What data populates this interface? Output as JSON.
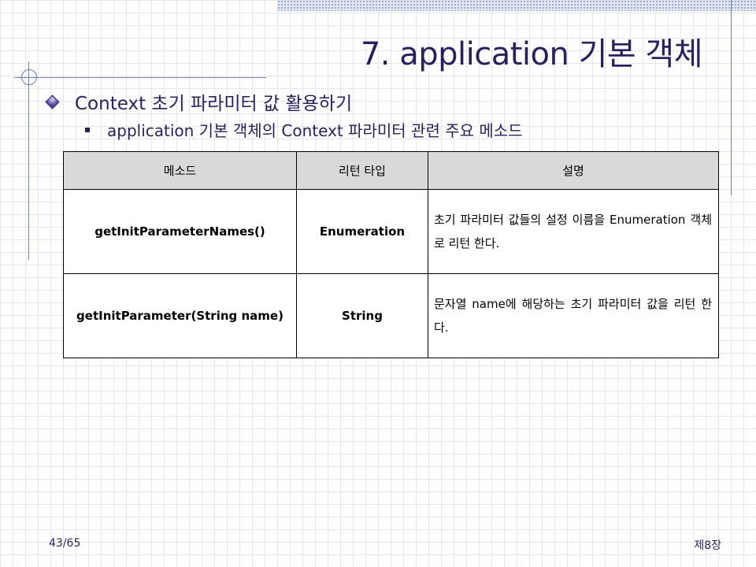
{
  "slide": {
    "title": "7. application 기본 객체",
    "bullet1": "Context 초기 파라미터 값 활용하기",
    "bullet2": "application 기본 객체의 Context 파라미터 관련 주요 메소드"
  },
  "table": {
    "headers": [
      "메소드",
      "리턴 타입",
      "설명"
    ],
    "rows": [
      {
        "method": "getInitParameterNames()",
        "return_type": "Enumeration",
        "description": "초기 파라미터 값들의 설정 이름을 Enumeration 객체로 리턴 한다."
      },
      {
        "method": "getInitParameter(String name)",
        "return_type": "String",
        "description": "문자열 name에 해당하는 초기 파라미터 값을 리턴 한다."
      }
    ]
  },
  "footer": {
    "page": "43/65",
    "chapter": "제8장"
  },
  "colors": {
    "text_primary": "#2c1f5e",
    "accent_line": "#6f7fa8",
    "header_fill": "#d9d9d9"
  },
  "icons": {
    "bullet1": "diamond-bullet-icon",
    "bullet2": "square-bullet-icon"
  }
}
